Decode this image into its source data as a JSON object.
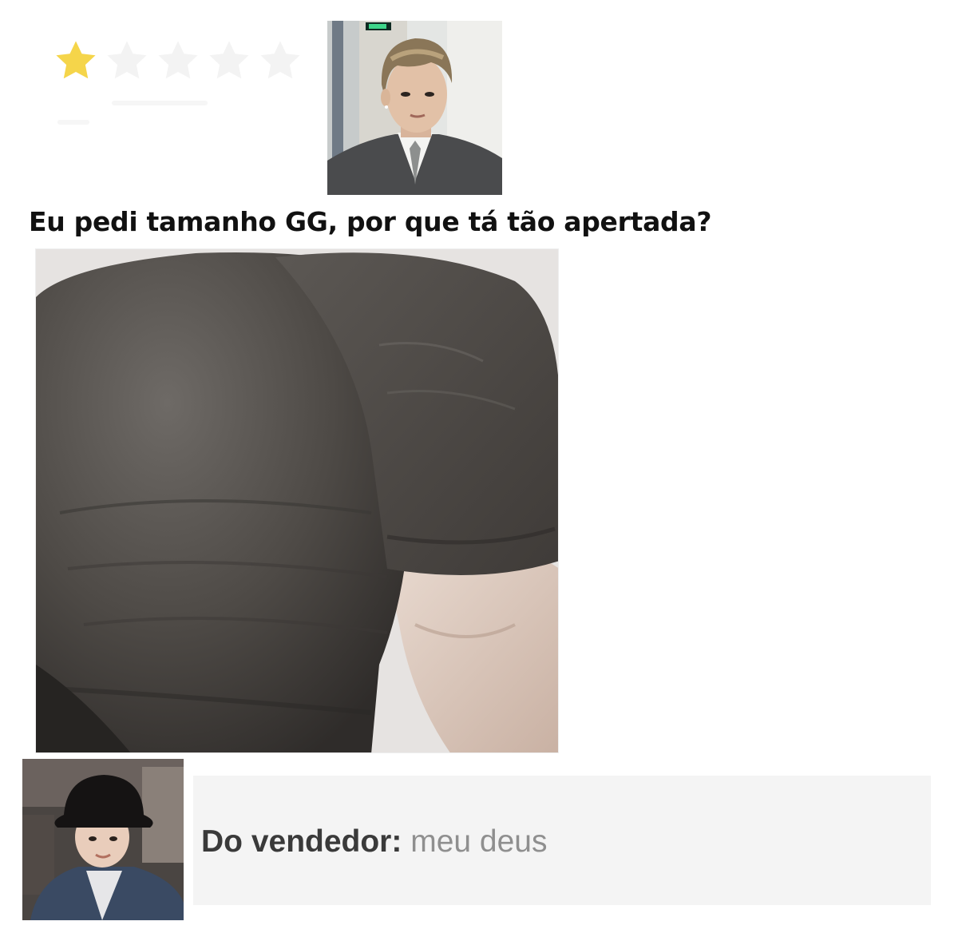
{
  "rating": {
    "value": 1,
    "max": 5,
    "filled_color": "#f5d54a",
    "empty_color": "#f0f0f0"
  },
  "review": {
    "text": "Eu pedi tamanho GG, por que tá tão apertada?"
  },
  "seller": {
    "label": "Do vendedor:",
    "reply": "meu deus"
  }
}
